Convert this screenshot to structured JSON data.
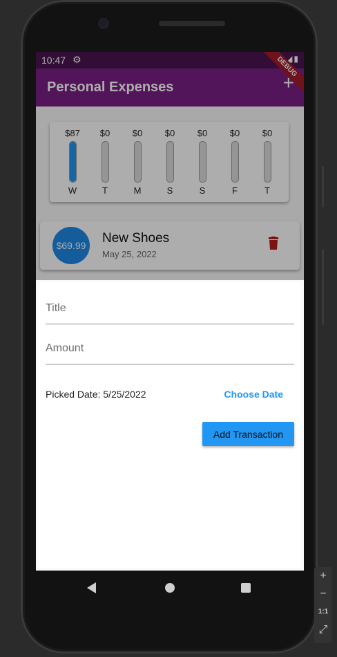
{
  "status_bar": {
    "time": "10:47",
    "settings_icon": "gear-icon",
    "system_icons": "▾◢▮"
  },
  "app_bar": {
    "title": "Personal Expenses",
    "add_icon": "plus-icon",
    "debug_banner": "DEBUG",
    "color": "#7a1f84"
  },
  "chart": {
    "bars": [
      {
        "amount": "$87",
        "day": "W",
        "fill": 1.0
      },
      {
        "amount": "$0",
        "day": "T",
        "fill": 0.0
      },
      {
        "amount": "$0",
        "day": "M",
        "fill": 0.0
      },
      {
        "amount": "$0",
        "day": "S",
        "fill": 0.0
      },
      {
        "amount": "$0",
        "day": "S",
        "fill": 0.0
      },
      {
        "amount": "$0",
        "day": "F",
        "fill": 0.0
      },
      {
        "amount": "$0",
        "day": "T",
        "fill": 0.0
      }
    ],
    "fill_color": "#2196f3"
  },
  "transaction": {
    "amount": "$69.99",
    "title": "New Shoes",
    "date": "May 25, 2022",
    "delete_icon": "trash-icon"
  },
  "form": {
    "title_placeholder": "Title",
    "amount_placeholder": "Amount",
    "picked_date": "Picked Date: 5/25/2022",
    "choose_date": "Choose Date",
    "submit": "Add Transaction"
  },
  "nav": {
    "back": "back-icon",
    "home": "home-icon",
    "recents": "recents-icon"
  },
  "emulator_toolbar": {
    "zoom_in": "+",
    "zoom_out": "−",
    "ratio": "1:1",
    "fit": "⤢"
  }
}
